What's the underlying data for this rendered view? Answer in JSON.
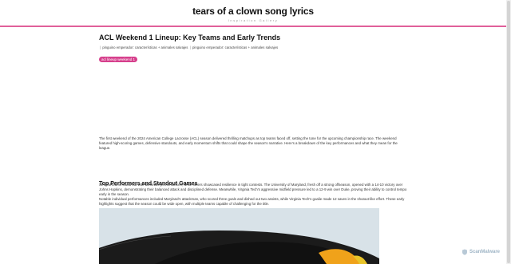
{
  "site": {
    "title": "tears of a clown song lyrics",
    "tagline": "Inspiration Gallery"
  },
  "article": {
    "title": "ACL Weekend 1 Lineup: Key Teams and Early Trends",
    "breadcrumbs": [
      "pinguino emperador: características + animales salvajes",
      "pinguino emperador: características + animales salvajes"
    ],
    "tag": "acl lineup weekend 1",
    "intro": "The first weekend of the 2024 American College Lacrosse (ACL) season delivered thrilling matchups as top teams faced off, setting the tone for the upcoming championship race. The weekend featured high-scoring games, defensive standouts, and early momentum shifts that could shape the season's narrative. Here's a breakdown of the key performances and what they mean for the league.",
    "section": {
      "heading": "Top Performers and Standout Games",
      "paragraph_1": "Several teams stood out with dominant performances, while others showcased resilience in tight contests. The University of Maryland, fresh off a strong offseason, opened with a 14-10 victory over Johns Hopkins, demonstrating their balanced attack and disciplined defense. Meanwhile, Virginia Tech's aggressive midfield pressure led to a 12-9 win over Duke, proving their ability to control tempo early in the season.",
      "paragraph_2": "Notable individual performances included Maryland's attackman, who scored three goals and dished out two assists, while Virginia Tech's goalie made 12 saves in the shutout-like effort. These early highlights suggest that the season could be wide open, with multiple teams capable of challenging for the title."
    }
  },
  "watermark": {
    "text": "ScanMalware",
    "color": "#9fb5c6"
  },
  "colors": {
    "accent": "#d63f8c",
    "header_border": "#e0609a"
  }
}
